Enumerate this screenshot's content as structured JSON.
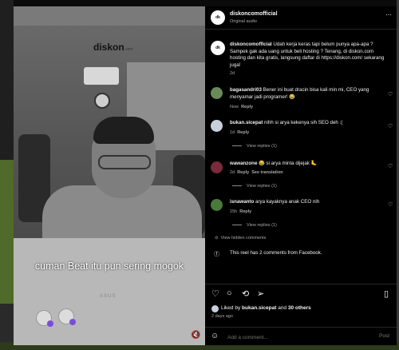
{
  "video": {
    "logo_text": "diskon",
    "logo_suffix": ".com",
    "caption": "cuman Beat itu pun sering mogok",
    "laptop_brand": "ASUS",
    "mute_icon": "speaker-mute-icon"
  },
  "header": {
    "account": "diskoncomofficial",
    "audio": "Original audio",
    "more_icon": "more-horizontal-icon"
  },
  "post": {
    "user": "diskoncomofficial",
    "caption": "Udah kerja keras tapi belum punya apa-apa ? Sampek gak ada uang untuk beli hosting ? Tenang, di diskon.com hosting dan kita gratis, langsung daftar di https://diskon.com/ sekarang juga!",
    "age": "2d"
  },
  "comments": [
    {
      "user": "bagasandri03",
      "text": "Bener ini buat dracin bisa kali min mi, CEO yang menyamar jadi programer! 😂",
      "age": "Now",
      "reply": "Reply"
    },
    {
      "user": "bukan.sicepat",
      "text": "nihh si arya kekenya sih SEO deh :(",
      "age": "1d",
      "reply": "Reply",
      "view_replies": "View replies (1)"
    },
    {
      "user": "wawanzone",
      "text": "😂 si arya minta dijejak 🦶",
      "age": "2d",
      "reply": "Reply",
      "see_translation": "See translation",
      "view_replies": "View replies (1)"
    },
    {
      "user": "isnawanto",
      "text": "arya kayaknya anak CEO nih",
      "age": "15h",
      "reply": "Reply",
      "view_replies": "View replies (1)"
    }
  ],
  "hidden": "View hidden comments",
  "facebook_note": "This reel has 2 comments from Facebook.",
  "likes": {
    "prefix": "Liked by",
    "user": "bukan.sicepat",
    "middle": "and",
    "others": "30 others",
    "age": "2 days ago"
  },
  "input": {
    "placeholder": "Add a comment...",
    "post_label": "Post"
  },
  "colors": {
    "panel_bg": "#000000",
    "accent": "#0095f6",
    "muted": "#a8a8a8"
  }
}
